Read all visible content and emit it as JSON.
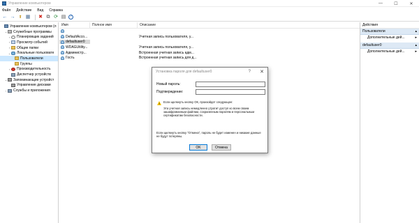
{
  "window": {
    "title": "Управление компьютером",
    "controls": {
      "minimize": "—",
      "maximize": "☐",
      "close": "✕"
    }
  },
  "menu": [
    "Файл",
    "Действие",
    "Вид",
    "Справка"
  ],
  "toolbar": {
    "back": "←",
    "forward": "→",
    "up": "⬆",
    "show_hide": "▦",
    "delete": "✖",
    "properties": "⧉",
    "refresh": "⟳",
    "export": "▤",
    "help": "?"
  },
  "tree": [
    {
      "label": "Управление компьютером (л",
      "expand": "",
      "icon": "comp",
      "indent": 0
    },
    {
      "label": "Служебные программы",
      "expand": "⌄",
      "icon": "tool",
      "indent": 1
    },
    {
      "label": "Планировщик заданий",
      "expand": "›",
      "icon": "clock",
      "indent": 2
    },
    {
      "label": "Просмотр событий",
      "expand": "›",
      "icon": "log",
      "indent": 2
    },
    {
      "label": "Общие папки",
      "expand": "›",
      "icon": "folder",
      "indent": 2
    },
    {
      "label": "Локальные пользовате",
      "expand": "⌄",
      "icon": "users",
      "indent": 2
    },
    {
      "label": "Пользователи",
      "expand": "",
      "icon": "folder",
      "indent": 3
    },
    {
      "label": "Группы",
      "expand": "",
      "icon": "folder",
      "indent": 3
    },
    {
      "label": "Производительность",
      "expand": "›",
      "icon": "perf",
      "indent": 2
    },
    {
      "label": "Диспетчер устройств",
      "expand": "",
      "icon": "dev",
      "indent": 2
    },
    {
      "label": "Запоминающие устройст",
      "expand": "⌄",
      "icon": "disk",
      "indent": 1
    },
    {
      "label": "Управление дисками",
      "expand": "",
      "icon": "disk",
      "indent": 2
    },
    {
      "label": "Службы и приложения",
      "expand": "›",
      "icon": "svc",
      "indent": 1
    }
  ],
  "list": {
    "columns": [
      "Имя",
      "Полное имя",
      "Описание"
    ],
    "rows": [
      {
        "name": "",
        "full": "",
        "desc": ""
      },
      {
        "name": "DefaultAcco...",
        "full": "",
        "desc": "Учетная запись пользователя, у..."
      },
      {
        "name": "defaultuser0",
        "full": "",
        "desc": ""
      },
      {
        "name": "WDAGUtility...",
        "full": "",
        "desc": "Учетная запись пользователя, у..."
      },
      {
        "name": "Администр...",
        "full": "",
        "desc": "Встроенная учетная запись адм..."
      },
      {
        "name": "Гость",
        "full": "",
        "desc": "Встроенная учетная запись для д..."
      }
    ]
  },
  "actions": {
    "title": "Действия",
    "sections": [
      {
        "label": "Пользователи",
        "items": [
          "Дополнительные дей..."
        ]
      },
      {
        "label": "defaultuser0",
        "items": [
          "Дополнительные дей..."
        ]
      }
    ],
    "chevron_up": "▴",
    "arrow": "▸"
  },
  "dialog": {
    "title": "Установка пароля для defaultuser0",
    "help": "?",
    "close": "✕",
    "new_password_label": "Новый пароль:",
    "confirm_label": "Подтверждение:",
    "warn_heading": "Если щелкнуть кнопку ОК, произойдет следующее:",
    "warn_body": "Эта учетная запись немедленно утратит доступ ко всем своим зашифрованным файлам, сохраненным паролям и персональным сертификатам безопасности.",
    "cancel_note": "Если щелкнуть кнопку \"Отмена\", пароль не будет изменен и никакие данные не будут потеряны.",
    "ok": "OK",
    "cancel": "Отмена"
  }
}
